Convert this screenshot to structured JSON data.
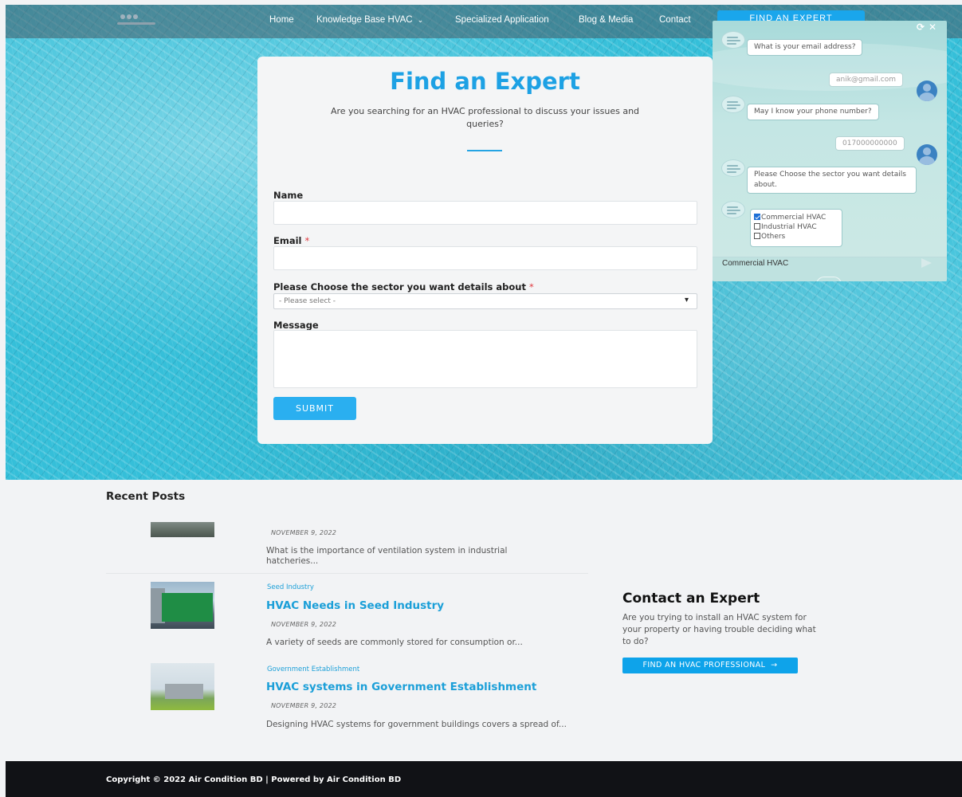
{
  "nav": {
    "items": [
      {
        "label": "Home"
      },
      {
        "label": "Knowledge Base HVAC",
        "has_dropdown": true
      },
      {
        "label": "Specialized Application"
      },
      {
        "label": "Blog & Media"
      },
      {
        "label": "Contact"
      }
    ],
    "cta_label": "FIND AN EXPERT"
  },
  "form": {
    "title": "Find an Expert",
    "description": "Are you searching for an HVAC professional to discuss your issues and queries?",
    "fields": {
      "name_label": "Name",
      "email_label": "Email",
      "sector_label": "Please Choose the sector you want details about",
      "sector_placeholder": "- Please select -",
      "message_label": "Message",
      "required_mark": "*"
    },
    "submit_label": "SUBMIT"
  },
  "chat": {
    "messages": [
      {
        "from": "bot",
        "text": "What is your email address?"
      },
      {
        "from": "user",
        "text": "anik@gmail.com"
      },
      {
        "from": "bot",
        "text": "May I know your phone number?"
      },
      {
        "from": "user",
        "text": "017000000000"
      },
      {
        "from": "bot",
        "text": "Please Choose the sector you want details about."
      }
    ],
    "options": [
      {
        "label": "Commercial HVAC",
        "checked": true
      },
      {
        "label": "Industrial HVAC",
        "checked": false
      },
      {
        "label": "Others",
        "checked": false
      }
    ],
    "input_value": "Commercial HVAC",
    "controls": {
      "refresh": "⟳",
      "close": "✕"
    }
  },
  "recent_posts": {
    "title": "Recent Posts",
    "posts": [
      {
        "category": "",
        "title": "",
        "date": "NOVEMBER 9, 2022",
        "excerpt": "What is the importance of ventilation system in industrial hatcheries..."
      },
      {
        "category": "Seed Industry",
        "title": "HVAC Needs in Seed Industry",
        "date": "NOVEMBER 9, 2022",
        "excerpt": "A variety of seeds are commonly stored for consumption or..."
      },
      {
        "category": "Government Establishment",
        "title": "HVAC systems in Government Establishment",
        "date": "NOVEMBER 9, 2022",
        "excerpt": "Designing HVAC systems for government buildings covers a spread of..."
      }
    ]
  },
  "contact_expert": {
    "title": "Contact an Expert",
    "description": "Are you trying to install an HVAC system for your property or having trouble deciding what to do?",
    "button_label": "FIND AN HVAC PROFESSIONAL",
    "button_arrow": "→"
  },
  "footer": {
    "text": "Copyright © 2022 Air Condition BD | Powered by Air Condition BD"
  },
  "colors": {
    "accent": "#1da1e4",
    "hero_bg": "#35bfd9",
    "footer_bg": "#111216"
  }
}
